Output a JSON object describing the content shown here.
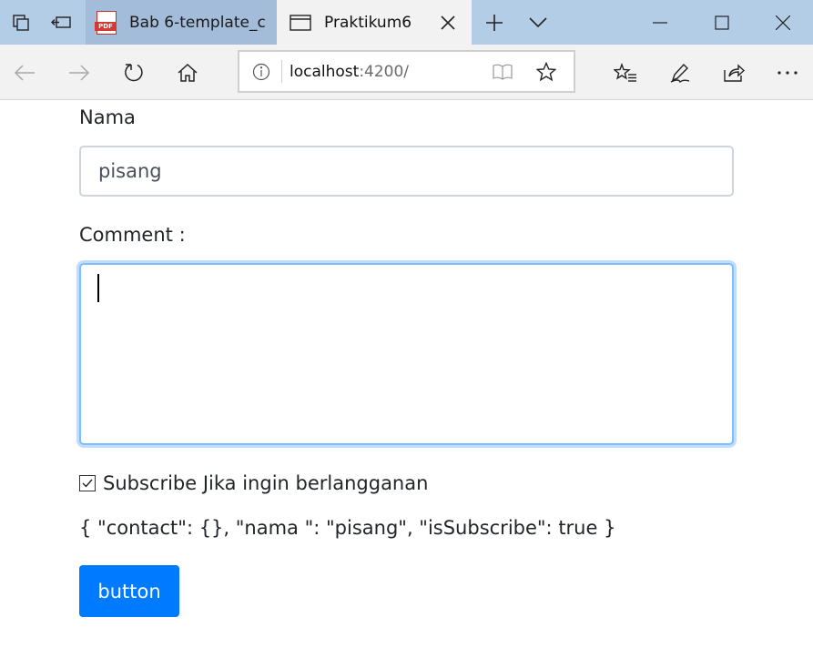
{
  "browser": {
    "tabs": [
      {
        "label": "Bab 6-template_c",
        "icon": "pdf-icon",
        "active": false
      },
      {
        "label": "Praktikum6",
        "icon": "page-icon",
        "active": true
      }
    ],
    "pdf_badge": "PDF",
    "address": {
      "host": "localhost",
      "path": ":4200/"
    },
    "accent": "#b4cde7"
  },
  "form": {
    "nama_label": "Nama",
    "nama_value": "pisang",
    "comment_label": "Comment :",
    "comment_value": "",
    "subscribe_label": "Subscribe Jika ingin berlangganan",
    "subscribe_checked": true,
    "json_output": "{ \"contact\": {}, \"nama \": \"pisang\", \"isSubscribe\": true }",
    "button_label": "button",
    "button_color": "#007bff"
  }
}
